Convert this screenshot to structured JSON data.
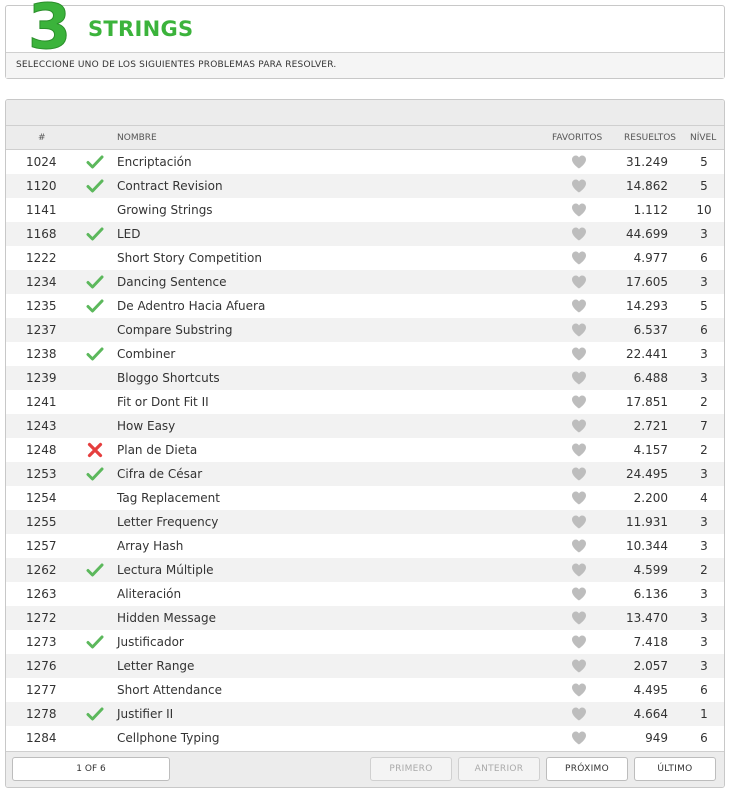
{
  "category": {
    "number": "3",
    "title": "STRINGS",
    "subtitle": "SELECCIONE UNO DE LOS SIGUIENTES PROBLEMAS PARA RESOLVER.",
    "accent_color": "#3bb33b"
  },
  "table": {
    "columns": {
      "id": "#",
      "name": "NOMBRE",
      "favorites": "FAVORITOS",
      "solved": "RESUELTOS",
      "level": "NÍVEL"
    },
    "status_colors": {
      "solved": "#5cb85c",
      "failed": "#e53e3e",
      "heart": "#bdbdbd"
    },
    "rows": [
      {
        "id": "1024",
        "status": "solved",
        "name": "Encriptación",
        "solved": "31.249",
        "level": "5"
      },
      {
        "id": "1120",
        "status": "solved",
        "name": "Contract Revision",
        "solved": "14.862",
        "level": "5"
      },
      {
        "id": "1141",
        "status": "none",
        "name": "Growing Strings",
        "solved": "1.112",
        "level": "10"
      },
      {
        "id": "1168",
        "status": "solved",
        "name": "LED",
        "solved": "44.699",
        "level": "3"
      },
      {
        "id": "1222",
        "status": "none",
        "name": "Short Story Competition",
        "solved": "4.977",
        "level": "6"
      },
      {
        "id": "1234",
        "status": "solved",
        "name": "Dancing Sentence",
        "solved": "17.605",
        "level": "3"
      },
      {
        "id": "1235",
        "status": "solved",
        "name": "De Adentro Hacia Afuera",
        "solved": "14.293",
        "level": "5"
      },
      {
        "id": "1237",
        "status": "none",
        "name": "Compare Substring",
        "solved": "6.537",
        "level": "6"
      },
      {
        "id": "1238",
        "status": "solved",
        "name": "Combiner",
        "solved": "22.441",
        "level": "3"
      },
      {
        "id": "1239",
        "status": "none",
        "name": "Bloggo Shortcuts",
        "solved": "6.488",
        "level": "3"
      },
      {
        "id": "1241",
        "status": "none",
        "name": "Fit or Dont Fit II",
        "solved": "17.851",
        "level": "2"
      },
      {
        "id": "1243",
        "status": "none",
        "name": "How Easy",
        "solved": "2.721",
        "level": "7"
      },
      {
        "id": "1248",
        "status": "failed",
        "name": "Plan de Dieta",
        "solved": "4.157",
        "level": "2"
      },
      {
        "id": "1253",
        "status": "solved",
        "name": "Cifra de César",
        "solved": "24.495",
        "level": "3"
      },
      {
        "id": "1254",
        "status": "none",
        "name": "Tag Replacement",
        "solved": "2.200",
        "level": "4"
      },
      {
        "id": "1255",
        "status": "none",
        "name": "Letter Frequency",
        "solved": "11.931",
        "level": "3"
      },
      {
        "id": "1257",
        "status": "none",
        "name": "Array Hash",
        "solved": "10.344",
        "level": "3"
      },
      {
        "id": "1262",
        "status": "solved",
        "name": "Lectura Múltiple",
        "solved": "4.599",
        "level": "2"
      },
      {
        "id": "1263",
        "status": "none",
        "name": "Aliteración",
        "solved": "6.136",
        "level": "3"
      },
      {
        "id": "1272",
        "status": "none",
        "name": "Hidden Message",
        "solved": "13.470",
        "level": "3"
      },
      {
        "id": "1273",
        "status": "solved",
        "name": "Justificador",
        "solved": "7.418",
        "level": "3"
      },
      {
        "id": "1276",
        "status": "none",
        "name": "Letter Range",
        "solved": "2.057",
        "level": "3"
      },
      {
        "id": "1277",
        "status": "none",
        "name": "Short Attendance",
        "solved": "4.495",
        "level": "6"
      },
      {
        "id": "1278",
        "status": "solved",
        "name": "Justifier II",
        "solved": "4.664",
        "level": "1"
      },
      {
        "id": "1284",
        "status": "none",
        "name": "Cellphone Typing",
        "solved": "949",
        "level": "6"
      }
    ]
  },
  "pagination": {
    "info": "1 OF 6",
    "first": "PRIMERO",
    "previous": "ANTERIOR",
    "next": "PRÓXIMO",
    "last": "ÚLTIMO"
  }
}
